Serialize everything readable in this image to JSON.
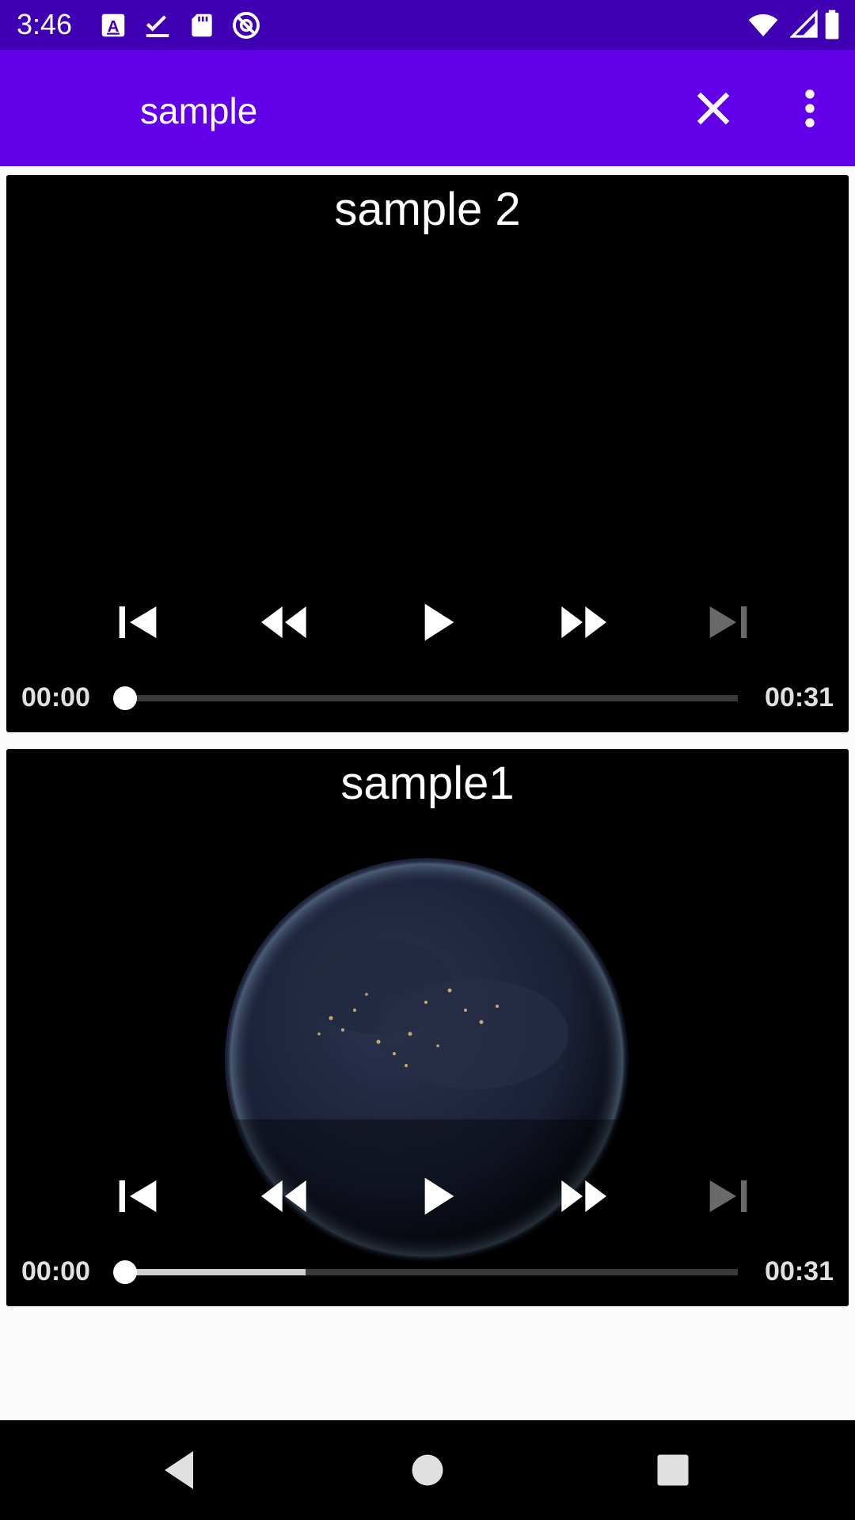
{
  "status_bar": {
    "time": "3:46",
    "left_icons": [
      "font-a-icon",
      "task-check-icon",
      "sd-card-icon",
      "blocked-at-icon"
    ],
    "right_icons": [
      "wifi-icon",
      "signal-icon",
      "battery-icon"
    ]
  },
  "app_bar": {
    "title": "sample",
    "close_icon": "close-icon",
    "more_icon": "more-vert-icon",
    "color": "#6200ea"
  },
  "players": [
    {
      "title": "sample 2",
      "position": "00:00",
      "duration": "00:31",
      "buffered_fraction": 0.0,
      "progress_fraction": 0.0,
      "has_frame": false,
      "controls": [
        "previous-icon",
        "rewind-icon",
        "play-icon",
        "fast-forward-icon",
        "next-icon"
      ]
    },
    {
      "title": "sample1",
      "position": "00:00",
      "duration": "00:31",
      "buffered_fraction": 0.3,
      "progress_fraction": 0.0,
      "has_frame": true,
      "controls": [
        "previous-icon",
        "rewind-icon",
        "play-icon",
        "fast-forward-icon",
        "next-icon"
      ]
    }
  ],
  "nav_bar": {
    "buttons": [
      "back-icon",
      "home-icon",
      "recents-icon"
    ]
  }
}
